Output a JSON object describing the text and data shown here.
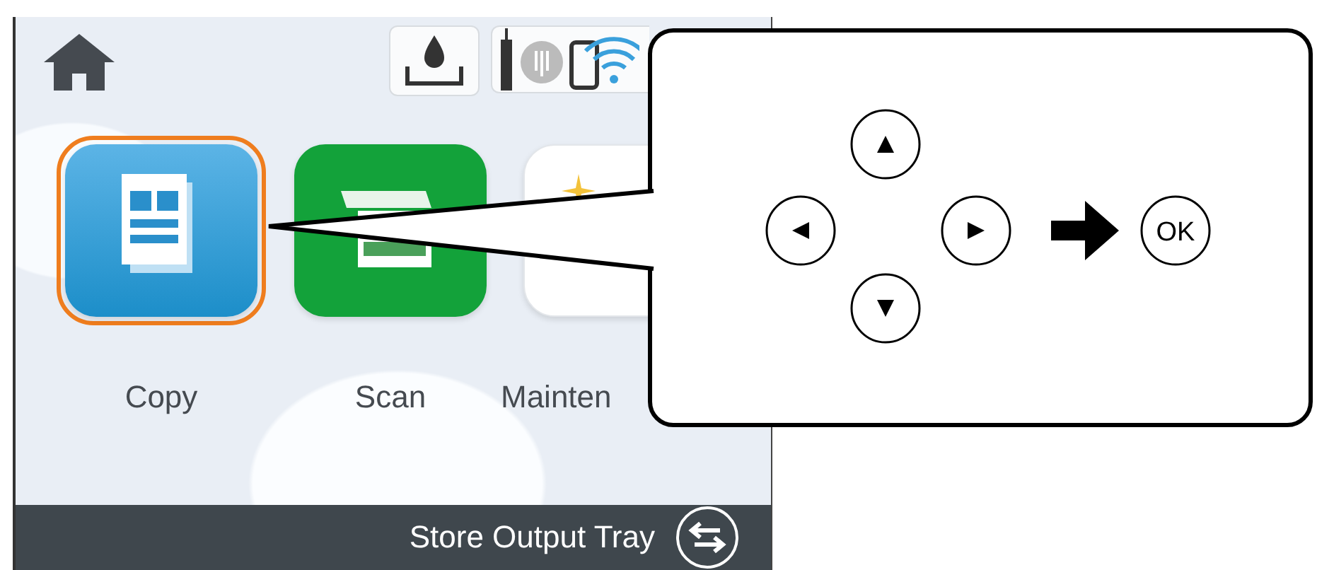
{
  "screen": {
    "apps": [
      {
        "kind": "copy",
        "label": "Copy",
        "selected": true
      },
      {
        "kind": "scan",
        "label": "Scan",
        "selected": false
      },
      {
        "kind": "maintenance",
        "label": "Mainten",
        "selected": false
      }
    ],
    "bottom_bar": {
      "label": "Store Output Tray"
    }
  },
  "callout": {
    "ok_label": "OK"
  }
}
